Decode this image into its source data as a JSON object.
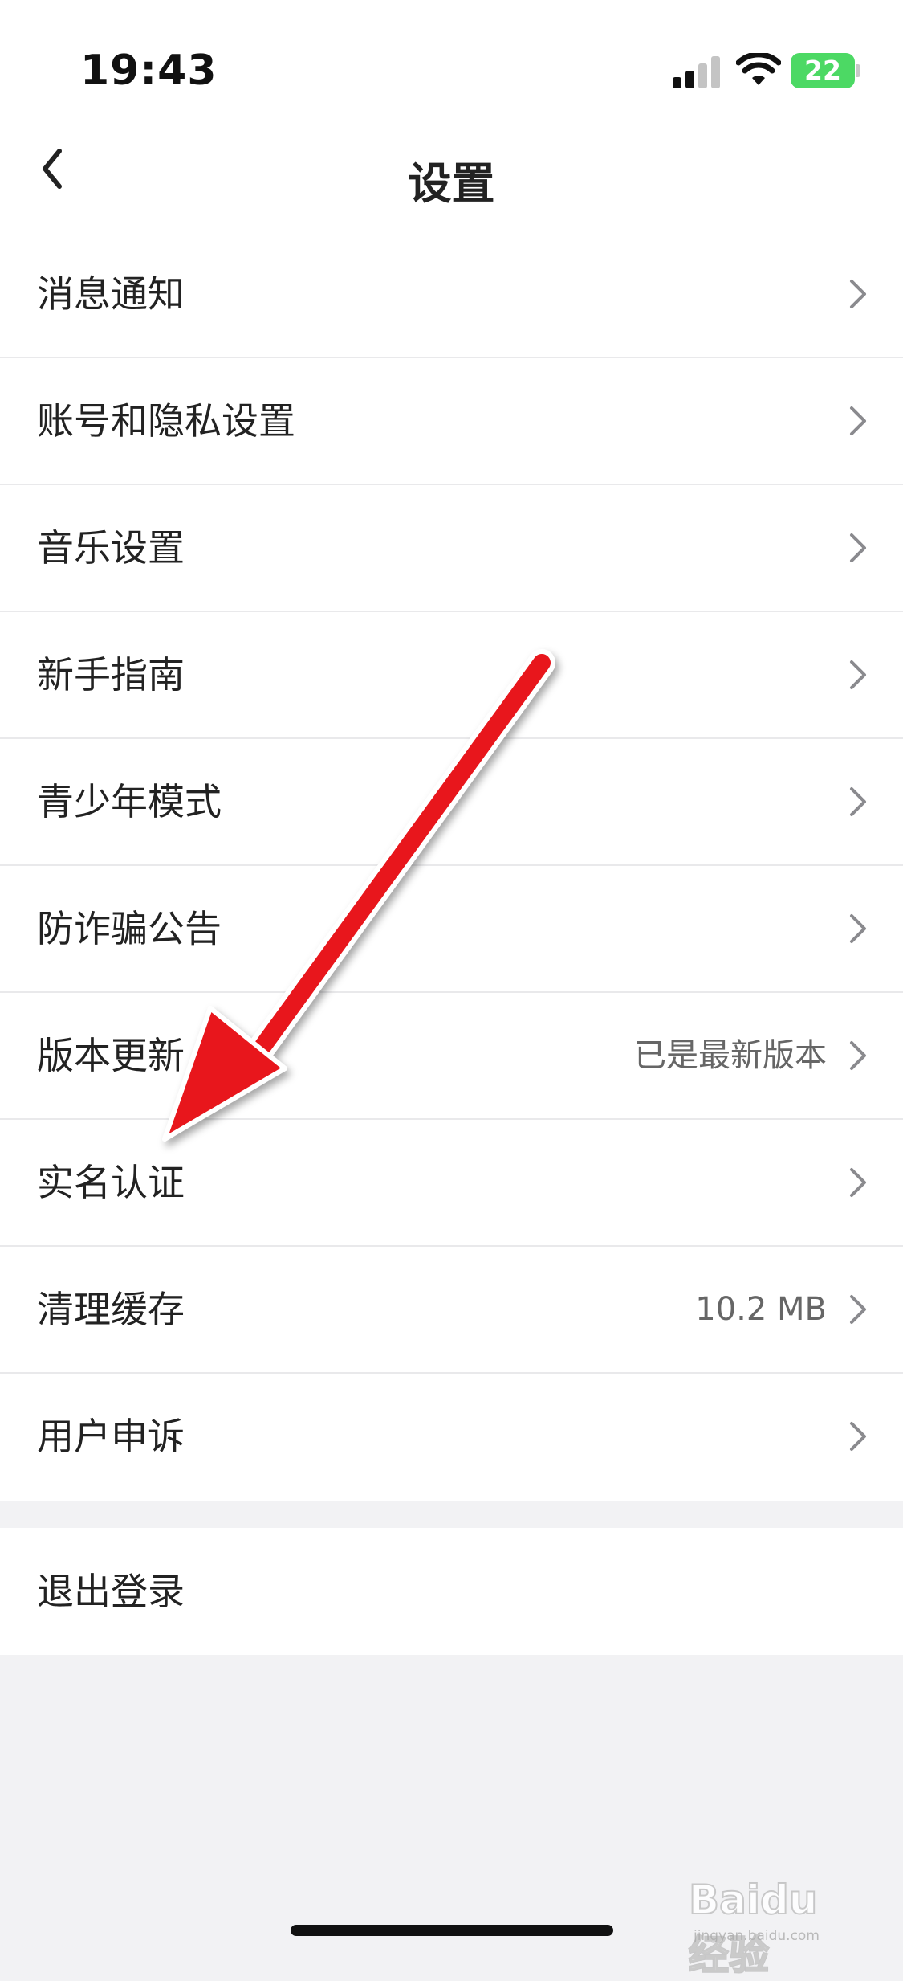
{
  "status_bar": {
    "time": "19:43",
    "battery": "22"
  },
  "header": {
    "back_icon": "chevron-left-icon",
    "title": "设置"
  },
  "menu": {
    "items": [
      {
        "label": "消息通知",
        "value": ""
      },
      {
        "label": "账号和隐私设置",
        "value": ""
      },
      {
        "label": "音乐设置",
        "value": ""
      },
      {
        "label": "新手指南",
        "value": ""
      },
      {
        "label": "青少年模式",
        "value": ""
      },
      {
        "label": "防诈骗公告",
        "value": ""
      },
      {
        "label": "版本更新",
        "value": "已是最新版本"
      },
      {
        "label": "实名认证",
        "value": ""
      },
      {
        "label": "清理缓存",
        "value": "10.2 MB"
      },
      {
        "label": "用户申诉",
        "value": ""
      }
    ],
    "logout_label": "退出登录"
  },
  "watermark": {
    "text": "Baidu经验",
    "sub": "jingyan.baidu.com"
  },
  "colors": {
    "arrow": "#e8141b",
    "battery": "#4cd964"
  }
}
